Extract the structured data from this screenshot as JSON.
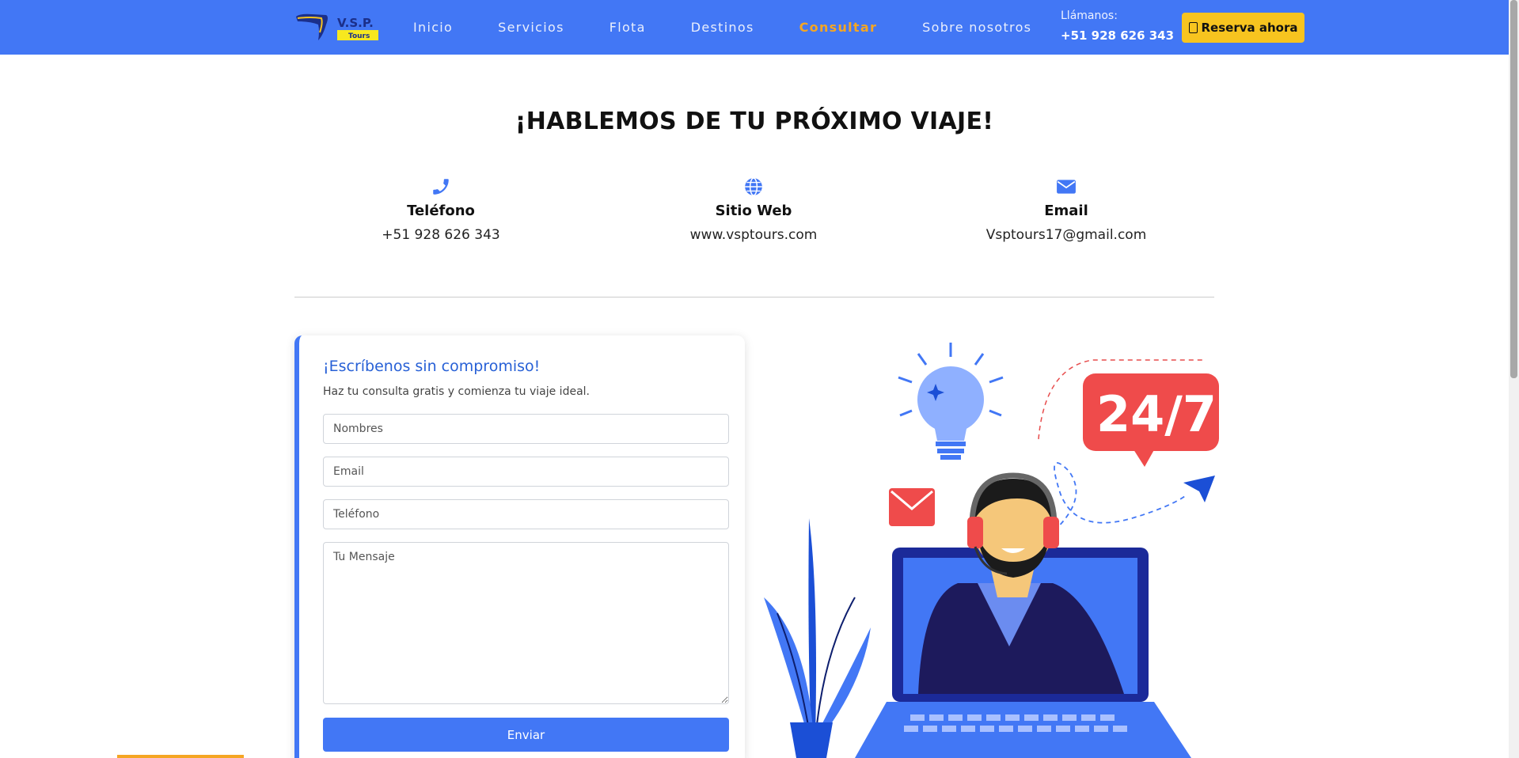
{
  "brand": {
    "logo_top": "V.S.P.",
    "logo_bottom": "Tours"
  },
  "nav": {
    "items": [
      {
        "label": "Inicio",
        "active": false
      },
      {
        "label": "Servicios",
        "active": false
      },
      {
        "label": "Flota",
        "active": false
      },
      {
        "label": "Destinos",
        "active": false
      },
      {
        "label": "Consultar",
        "active": true
      },
      {
        "label": "Sobre nosotros",
        "active": false
      }
    ],
    "call_label": "Llámanos:",
    "call_number": "+51 928 626 343",
    "reserve_label": "Reserva ahora"
  },
  "hero": {
    "title": "¡HABLEMOS DE TU PRÓXIMO VIAJE!"
  },
  "contacts": {
    "phone": {
      "label": "Teléfono",
      "value": "+51 928 626 343",
      "icon": "phone-icon"
    },
    "web": {
      "label": "Sitio Web",
      "value": "www.vsptours.com",
      "icon": "globe-icon"
    },
    "email": {
      "label": "Email",
      "value": "Vsptours17@gmail.com",
      "icon": "envelope-icon"
    }
  },
  "form": {
    "title": "¡Escríbenos sin compromiso!",
    "subtitle": "Haz tu consulta gratis y comienza tu viaje ideal.",
    "name_placeholder": "Nombres",
    "email_placeholder": "Email",
    "phone_placeholder": "Teléfono",
    "message_placeholder": "Tu Mensaje",
    "submit_label": "Enviar"
  },
  "illustration": {
    "badge": "24/7"
  },
  "colors": {
    "primary": "#4277f5",
    "accent": "#f5a623",
    "button_yellow": "#f7c41f"
  }
}
